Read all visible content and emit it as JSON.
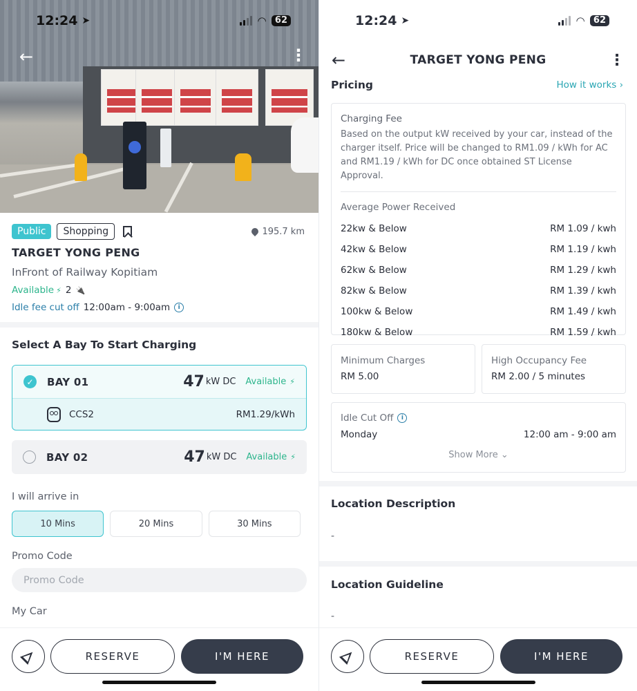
{
  "status": {
    "time": "12:24",
    "battery": "62"
  },
  "left": {
    "tags": {
      "public": "Public",
      "shopping": "Shopping"
    },
    "distance": "195.7 km",
    "station_name": "TARGET YONG PENG",
    "location": "InFront of Railway Kopitiam",
    "availability": "Available",
    "available_count": "2",
    "idle_label": "Idle fee cut off",
    "idle_time": "12:00am - 9:00am",
    "select_bay_title": "Select A Bay To Start Charging",
    "bays": [
      {
        "name": "BAY 01",
        "kw": "47",
        "unit": "kW DC",
        "status": "Available",
        "connector": "CCS2",
        "price": "RM1.29/kWh",
        "selected": true
      },
      {
        "name": "BAY 02",
        "kw": "47",
        "unit": "kW DC",
        "status": "Available",
        "selected": false
      }
    ],
    "arrive_label": "I will arrive in",
    "arrive_options": [
      "10 Mins",
      "20 Mins",
      "30 Mins"
    ],
    "promo_label": "Promo Code",
    "promo_placeholder": "Promo Code",
    "my_car_label": "My Car"
  },
  "right": {
    "title": "TARGET YONG PENG",
    "pricing_title": "Pricing",
    "how_it_works": "How it works",
    "charging_fee_title": "Charging Fee",
    "charging_fee_desc": "Based on the output kW received by your car, instead of the charger itself. Price will be changed to RM1.09 / kWh for AC and RM1.19 / kWh for DC once obtained ST License Approval.",
    "avg_power_title": "Average Power Received",
    "tiers": [
      {
        "label": "22kw & Below",
        "price": "RM 1.09 / kwh"
      },
      {
        "label": "42kw & Below",
        "price": "RM 1.19 / kwh"
      },
      {
        "label": "62kw & Below",
        "price": "RM 1.29 / kwh"
      },
      {
        "label": "82kw & Below",
        "price": "RM 1.39 / kwh"
      },
      {
        "label": "100kw & Below",
        "price": "RM 1.49 / kwh"
      },
      {
        "label": "180kw & Below",
        "price": "RM 1.59 / kwh"
      }
    ],
    "minimum_charges_title": "Minimum Charges",
    "minimum_charges_value": "RM 5.00",
    "high_occupancy_title": "High Occupancy Fee",
    "high_occupancy_value": "RM 2.00 / 5 minutes",
    "idle_cut_off_title": "Idle Cut Off",
    "idle_day": "Monday",
    "idle_hours": "12:00 am - 9:00 am",
    "show_more": "Show More",
    "location_description_title": "Location Description",
    "location_description_value": "-",
    "location_guideline_title": "Location Guideline",
    "location_guideline_value": "-"
  },
  "actions": {
    "reserve": "RESERVE",
    "here": "I'M HERE"
  },
  "colors": {
    "accent": "#3ec4cf",
    "available": "#2db58c",
    "primary_button": "#363d4b"
  },
  "icons": [
    "back-arrow-icon",
    "more-vertical-icon",
    "bookmark-icon",
    "location-pin-icon",
    "lightning-icon",
    "plug-icon",
    "info-icon",
    "check-icon",
    "chevron-right-icon",
    "chevron-down-icon",
    "navigate-icon"
  ]
}
